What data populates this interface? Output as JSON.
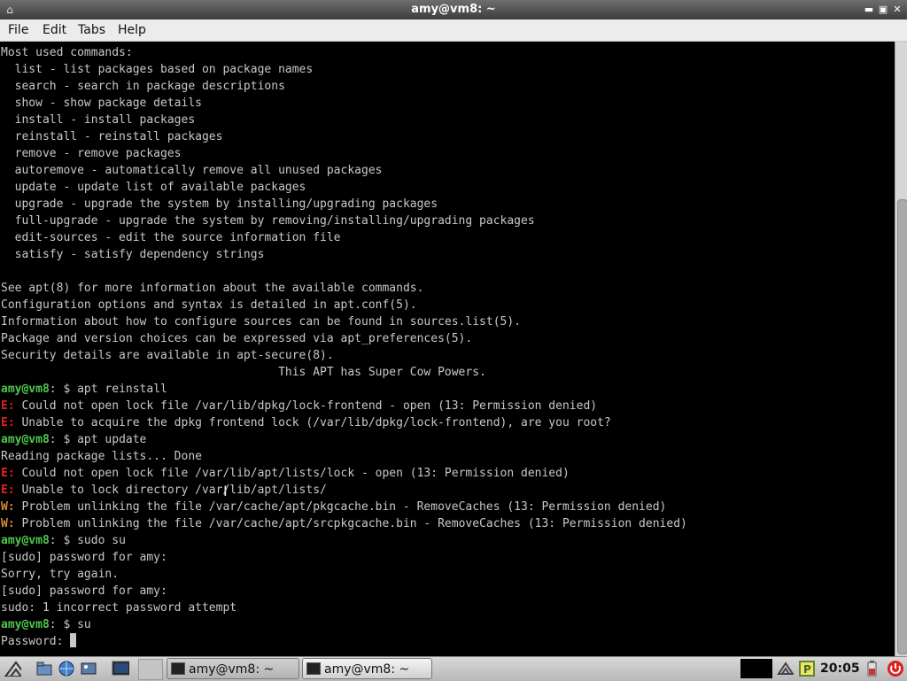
{
  "window": {
    "title": "amy@vm8: ~",
    "controls": {
      "minimize": "▬",
      "maximize": "▣",
      "close": "✕"
    }
  },
  "menubar": {
    "items": [
      {
        "label": "File"
      },
      {
        "label": "Edit"
      },
      {
        "label": "Tabs"
      },
      {
        "label": "Help"
      }
    ]
  },
  "terminal": {
    "prompt_user": "amy@vm8",
    "prompt_path": ": $ ",
    "output": [
      "Most used commands:",
      "  list - list packages based on package names",
      "  search - search in package descriptions",
      "  show - show package details",
      "  install - install packages",
      "  reinstall - reinstall packages",
      "  remove - remove packages",
      "  autoremove - automatically remove all unused packages",
      "  update - update list of available packages",
      "  upgrade - upgrade the system by installing/upgrading packages",
      "  full-upgrade - upgrade the system by removing/installing/upgrading packages",
      "  edit-sources - edit the source information file",
      "  satisfy - satisfy dependency strings",
      "",
      "See apt(8) for more information about the available commands.",
      "Configuration options and syntax is detailed in apt.conf(5).",
      "Information about how to configure sources can be found in sources.list(5).",
      "Package and version choices can be expressed via apt_preferences(5).",
      "Security details are available in apt-secure(8).",
      "                                        This APT has Super Cow Powers."
    ],
    "session": [
      {
        "cmd": "apt reinstall"
      },
      {
        "tag": "E:",
        "text": " Could not open lock file /var/lib/dpkg/lock-frontend - open (13: Permission denied)"
      },
      {
        "tag": "E:",
        "text": " Unable to acquire the dpkg frontend lock (/var/lib/dpkg/lock-frontend), are you root?"
      },
      {
        "cmd": "apt update"
      },
      {
        "text": "Reading package lists... Done"
      },
      {
        "tag": "E:",
        "text": " Could not open lock file /var/lib/apt/lists/lock - open (13: Permission denied)"
      },
      {
        "tag": "E:",
        "text": " Unable to lock directory /var/lib/apt/lists/"
      },
      {
        "tag": "W:",
        "text": " Problem unlinking the file /var/cache/apt/pkgcache.bin - RemoveCaches (13: Permission denied)"
      },
      {
        "tag": "W:",
        "text": " Problem unlinking the file /var/cache/apt/srcpkgcache.bin - RemoveCaches (13: Permission denied)"
      },
      {
        "cmd": "sudo su"
      },
      {
        "text": "[sudo] password for amy:"
      },
      {
        "text": "Sorry, try again."
      },
      {
        "text": "[sudo] password for amy:"
      },
      {
        "text": "sudo: 1 incorrect password attempt"
      },
      {
        "cmd": "su"
      },
      {
        "text": "Password: ",
        "cursor": true
      }
    ]
  },
  "taskbar": {
    "tasks": [
      {
        "label": "amy@vm8: ~"
      },
      {
        "label": "amy@vm8: ~"
      }
    ],
    "clock": "20:05",
    "icons": [
      "start-menu-icon",
      "file-manager-icon",
      "web-browser-icon",
      "terminal-icon",
      "desktop-icon",
      "network-icon",
      "package-updater-icon",
      "battery-icon",
      "power-icon"
    ]
  },
  "colors": {
    "prompt": "#4ec64e",
    "error": "#e02020",
    "warning": "#d88a2a",
    "text": "#c8c8c8",
    "background": "#000000"
  }
}
